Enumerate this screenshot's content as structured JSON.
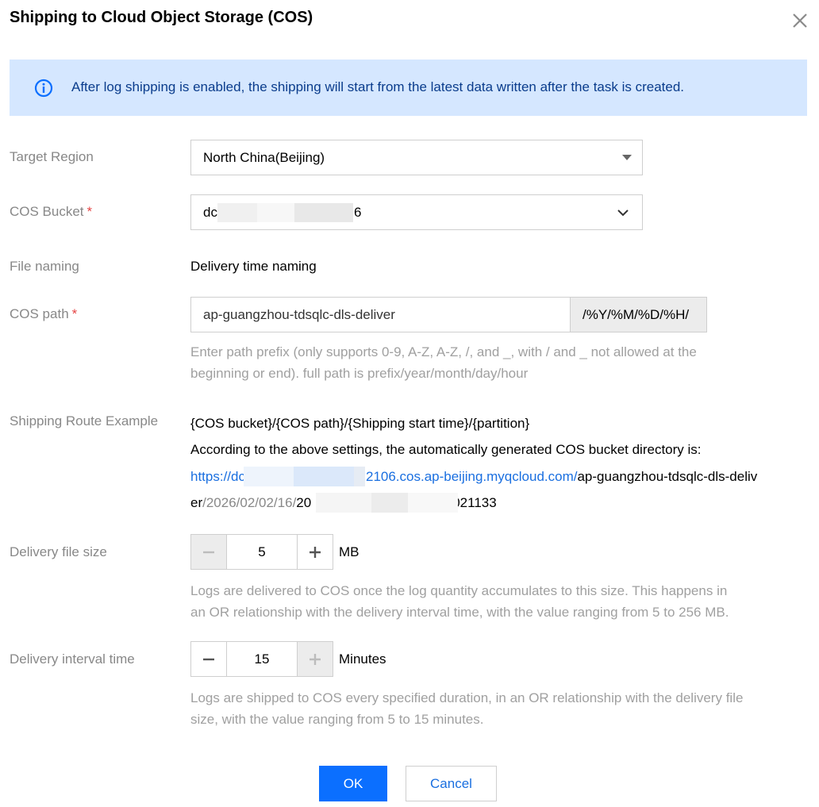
{
  "dialog": {
    "title": "Shipping to Cloud Object Storage (COS)",
    "info": "After log shipping is enabled, the shipping will start from the latest data written after the task is created."
  },
  "fields": {
    "target_region": {
      "label": "Target Region",
      "value": "North China(Beijing)"
    },
    "cos_bucket": {
      "label": "COS Bucket",
      "required_mark": "*",
      "value_start": "dc",
      "value_end": "6"
    },
    "file_naming": {
      "label": "File naming",
      "value": "Delivery time naming"
    },
    "cos_path": {
      "label": "COS path",
      "required_mark": "*",
      "value": "ap-guangzhou-tdsqlc-dls-deliver",
      "suffix": "/%Y/%M/%D/%H/",
      "help_line1": "Enter path prefix (only supports 0-9, A-Z, A-Z, /, and _, with / and _ not allowed at the",
      "help_line2": "beginning or end). full path is prefix/year/month/day/hour"
    },
    "route_example": {
      "label": "Shipping Route Example",
      "template": "{COS bucket}/{COS path}/{Shipping start time}/{partition}",
      "description": "According to the above settings, the automatically generated COS bucket directory is:",
      "url_start": "https://dc",
      "url_end": "2106.cos.ap-beijing.myqcloud.com/",
      "path_part1": "ap-guangzhou-tdsqlc-dls-deliv",
      "path_part2": "er",
      "date_part": "/2026/02/02/16/",
      "file_start": "20",
      "file_end": "021133"
    },
    "file_size": {
      "label": "Delivery file size",
      "value": "5",
      "unit": "MB",
      "help_line1": "Logs are delivered to COS once the log quantity accumulates to this size. This happens in",
      "help_line2": "an OR relationship with the delivery interval time, with the value ranging from 5 to 256 MB."
    },
    "interval": {
      "label": "Delivery interval time",
      "value": "15",
      "unit": "Minutes",
      "help_line1": "Logs are shipped to COS every specified duration, in an OR relationship with the delivery file",
      "help_line2": "size, with the value ranging from 5 to 15 minutes."
    }
  },
  "buttons": {
    "ok": "OK",
    "cancel": "Cancel"
  },
  "icons": {
    "close": "close-icon",
    "info": "info-icon",
    "region_caret": "caret-down-icon",
    "bucket_chevron": "chevron-down-icon",
    "minus": "minus-icon",
    "plus": "plus-icon"
  },
  "colors": {
    "primary": "#0b6fff",
    "banner_bg": "#d5e7ff",
    "banner_text": "#0a3c8c",
    "required": "#e54545",
    "link": "#1a6fe0"
  }
}
